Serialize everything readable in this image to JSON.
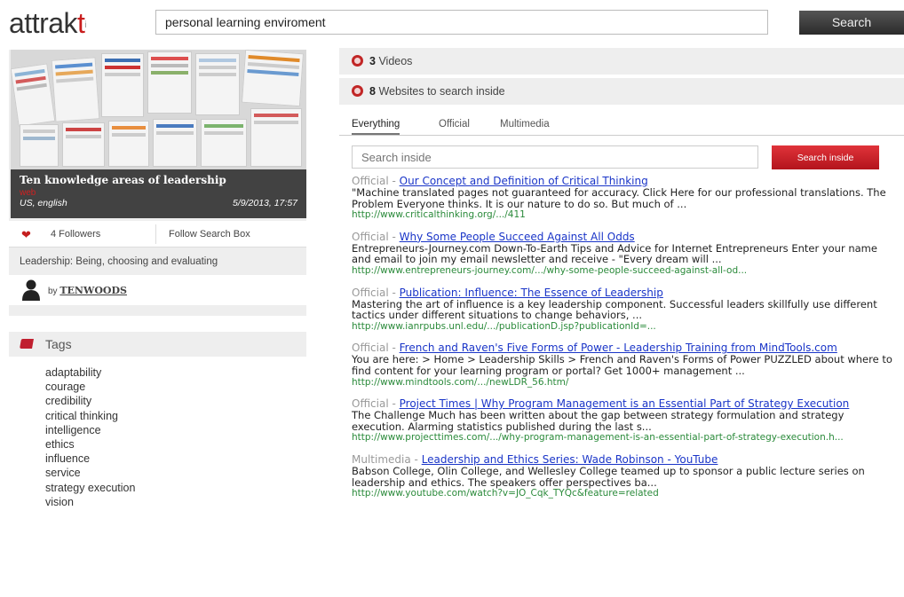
{
  "header": {
    "logo_main": "attrak",
    "logo_accent": "t",
    "logo_dot": "i",
    "search_value": "personal learning enviroment",
    "search_button": "Search"
  },
  "left": {
    "box_title": "Ten knowledge areas of leadership",
    "box_type": "web",
    "box_locale": "US, english",
    "box_date": "5/9/2013, 17:57",
    "followers": "4 Followers",
    "follow_link": "Follow Search Box",
    "description": "Leadership: Being, choosing and evaluating",
    "by_label": "by",
    "username": "TENWOODS",
    "tags_title": "Tags",
    "tags": [
      "adaptability",
      "courage",
      "credibility",
      "critical thinking",
      "intelligence",
      "ethics",
      "influence",
      "service",
      "strategy execution",
      "vision"
    ]
  },
  "right": {
    "videos_count": "3",
    "videos_label": "Videos",
    "websites_count": "8",
    "websites_label": "Websites to search inside",
    "tabs": [
      "Everything",
      "Official",
      "Multimedia"
    ],
    "inside_placeholder": "Search inside",
    "inside_button": "Search inside",
    "results": [
      {
        "source": "Official",
        "title": "Our Concept and Definition of Critical Thinking",
        "snippet": "\"Machine translated pages not guaranteed for accuracy. Click Here for our professional translations. The Problem Everyone thinks. It is our nature to do so. But much of ...",
        "url": "http://www.criticalthinking.org/.../411"
      },
      {
        "source": "Official",
        "title": "Why Some People Succeed Against All Odds",
        "snippet": "Entrepreneurs-Journey.com Down-To-Earth Tips and Advice for Internet Entrepreneurs Enter your name and email to join my email newsletter and receive - \"Every dream will ...",
        "url": "http://www.entrepreneurs-journey.com/.../why-some-people-succeed-against-all-od..."
      },
      {
        "source": "Official",
        "title": "Publication: Influence: The Essence of Leadership",
        "snippet": "Mastering the art of influence is a key leadership component. Successful leaders skillfully use different tactics under different situations to change behaviors, ...",
        "url": "http://www.ianrpubs.unl.edu/.../publicationD.jsp?publicationId=..."
      },
      {
        "source": "Official",
        "title": "French and Raven's Five Forms of Power - Leadership Training from MindTools.com",
        "snippet": "You are here: > Home > Leadership Skills > French and Raven's Forms of Power PUZZLED about where to find content for your learning program or portal? Get 1000+ management ...",
        "url": "http://www.mindtools.com/.../newLDR_56.htm/"
      },
      {
        "source": "Official",
        "title": "Project Times | Why Program Management is an Essential Part of Strategy Execution",
        "snippet": "The Challenge Much has been written about the gap between strategy formulation and strategy execution. Alarming statistics published during the last s...",
        "url": "http://www.projecttimes.com/.../why-program-management-is-an-essential-part-of-strategy-execution.h..."
      },
      {
        "source": "Multimedia",
        "title": "Leadership and Ethics Series: Wade Robinson - YouTube",
        "snippet": "Babson College, Olin College, and Wellesley College teamed up to sponsor a public lecture series on leadership and ethics. The speakers offer perspectives ba...",
        "url": "http://www.youtube.com/watch?v=JO_Cqk_TYQc&feature=related"
      }
    ]
  }
}
